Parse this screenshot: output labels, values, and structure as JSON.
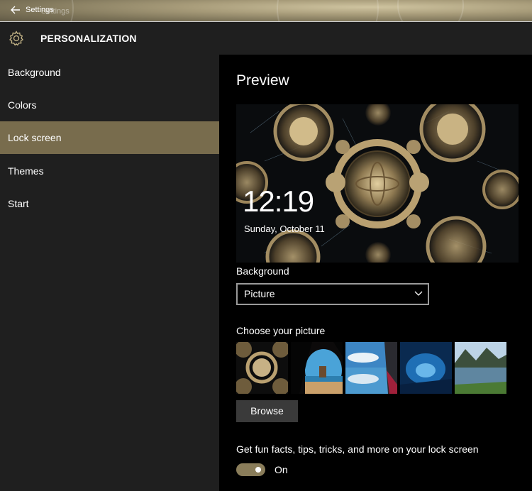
{
  "window": {
    "title": "Settings",
    "title_ghost": "Settings",
    "back_icon": "arrow-left-icon"
  },
  "header": {
    "icon": "gear-icon",
    "title": "PERSONALIZATION"
  },
  "sidebar": {
    "items": [
      {
        "label": "Background",
        "active": false
      },
      {
        "label": "Colors",
        "active": false
      },
      {
        "label": "Lock screen",
        "active": true
      },
      {
        "label": "Themes",
        "active": false
      },
      {
        "label": "Start",
        "active": false
      }
    ]
  },
  "main": {
    "preview_title": "Preview",
    "preview": {
      "time": "12:19",
      "date": "Sunday, October 11"
    },
    "background_label": "Background",
    "background_select": {
      "value": "Picture",
      "icon": "chevron-down-icon"
    },
    "choose_label": "Choose your picture",
    "thumbnails": [
      {
        "name": "fractal-thumbnail"
      },
      {
        "name": "beach-cave-thumbnail"
      },
      {
        "name": "sky-reflection-thumbnail"
      },
      {
        "name": "ice-cave-thumbnail"
      },
      {
        "name": "mountain-lake-thumbnail"
      }
    ],
    "browse_label": "Browse",
    "fun_facts_label": "Get fun facts, tips, tricks, and more on your lock screen",
    "toggle": {
      "state_label": "On",
      "on": true
    }
  },
  "colors": {
    "accent": "#786c4d",
    "sidebar_bg": "#1f1f1f",
    "main_bg": "#000000",
    "toggle_on": "#8a7d5a"
  }
}
